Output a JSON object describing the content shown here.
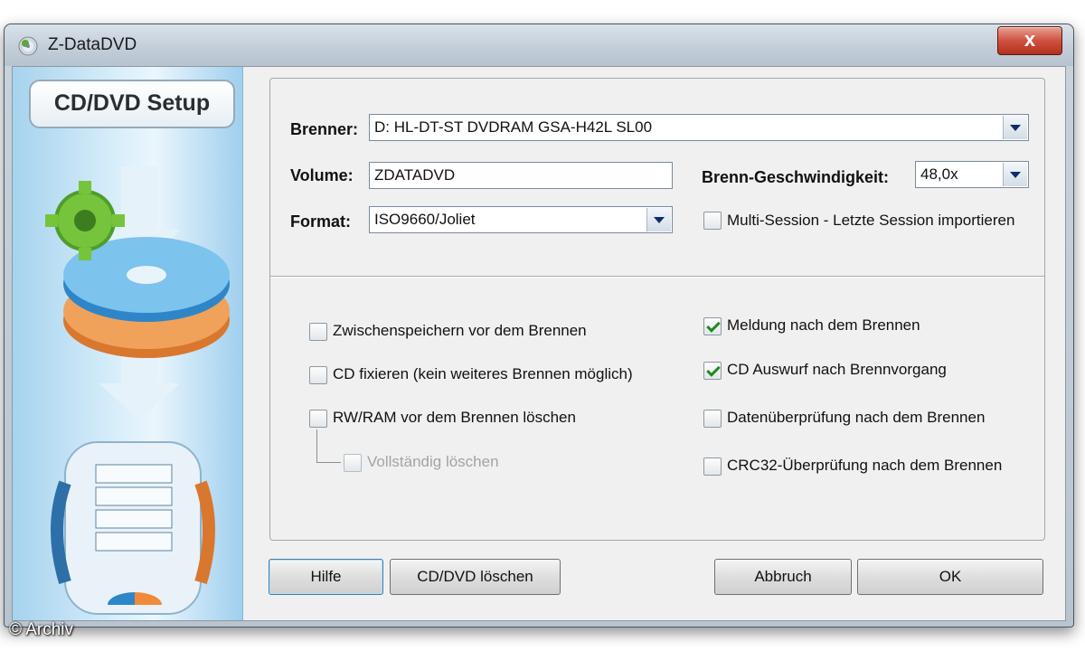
{
  "window": {
    "title": "Z-DataDVD",
    "close_glyph": "x"
  },
  "sidebar": {
    "setup_label": "CD/DVD Setup"
  },
  "fields": {
    "brenner": {
      "label": "Brenner:",
      "value": "D: HL-DT-ST DVDRAM GSA-H42L SL00"
    },
    "volume": {
      "label": "Volume:",
      "value": "ZDATADVD"
    },
    "speed": {
      "label": "Brenn-Geschwindigkeit:",
      "value": "48,0x"
    },
    "format": {
      "label": "Format:",
      "value": "ISO9660/Joliet"
    }
  },
  "options": {
    "multisession": {
      "label": "Multi-Session - Letzte Session importieren",
      "checked": false
    },
    "zwischenspeichern": {
      "label": "Zwischenspeichern vor dem Brennen",
      "checked": false
    },
    "fixieren": {
      "label": "CD fixieren (kein weiteres Brennen möglich)",
      "checked": false
    },
    "rwram": {
      "label": "RW/RAM vor dem Brennen löschen",
      "checked": false
    },
    "vollstaendig": {
      "label": "Vollständig löschen",
      "checked": false,
      "disabled": true
    },
    "meldung": {
      "label": "Meldung nach dem Brennen",
      "checked": true
    },
    "auswurf": {
      "label": "CD Auswurf nach Brennvorgang",
      "checked": true
    },
    "datenpruefung": {
      "label": "Datenüberprüfung nach dem Brennen",
      "checked": false
    },
    "crc32": {
      "label": "CRC32-Überprüfung nach dem Brennen",
      "checked": false
    }
  },
  "buttons": {
    "hilfe": "Hilfe",
    "cd_loeschen": "CD/DVD löschen",
    "abbruch": "Abbruch",
    "ok": "OK"
  },
  "watermark": "© Archiv",
  "colors": {
    "accent": "#3c7fb1",
    "check": "#1f8a1f",
    "close": "#c8402e"
  }
}
